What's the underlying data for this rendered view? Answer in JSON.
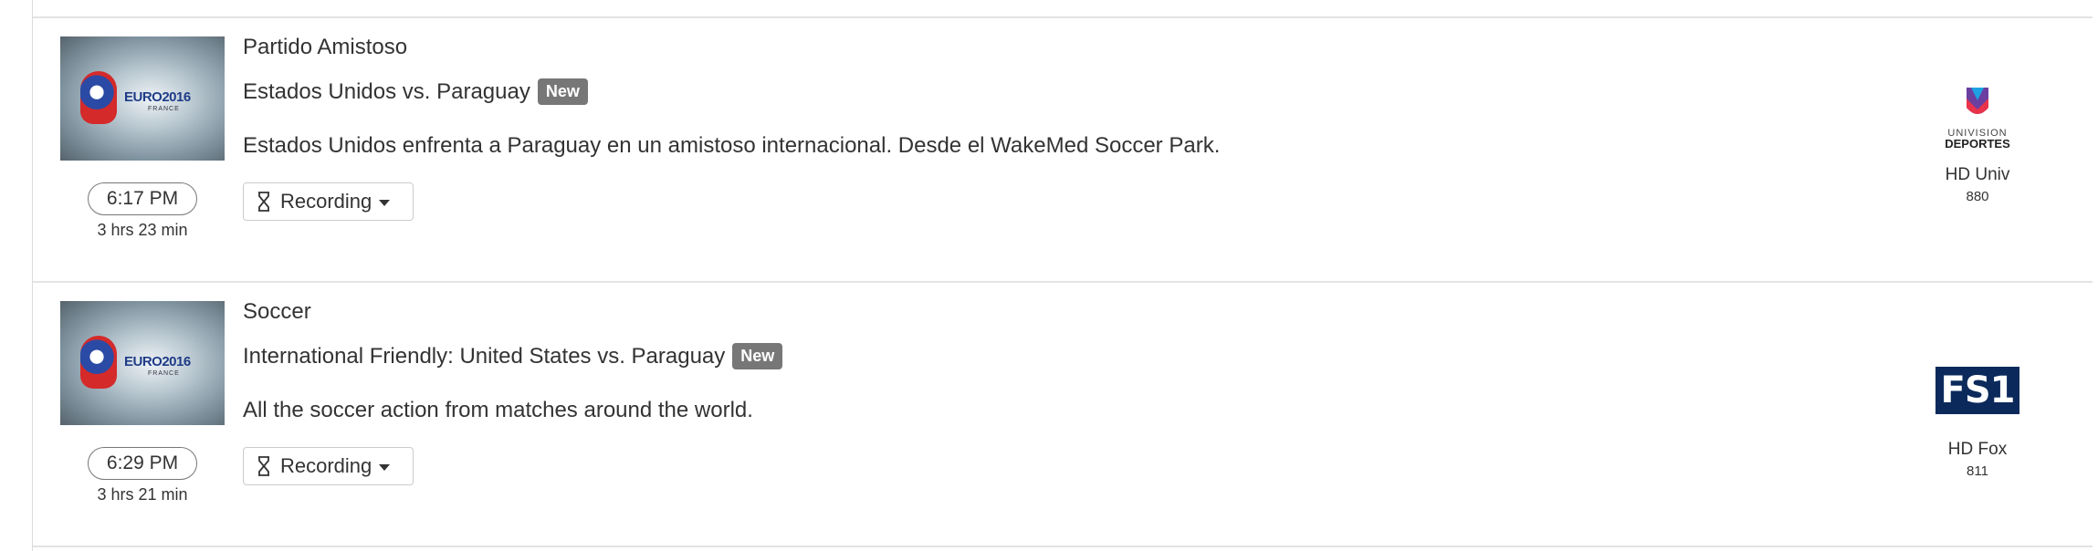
{
  "listings": [
    {
      "category": "Partido Amistoso",
      "title": "Estados Unidos vs. Paraguay",
      "badge": "New",
      "description": "Estados Unidos enfrenta a Paraguay en un amistoso internacional. Desde el WakeMed Soccer Park.",
      "time": "6:17 PM",
      "duration": "3 hrs 23 min",
      "recording_label": "Recording",
      "thumb_logo": "EURO2016",
      "thumb_sub": "FRANCE",
      "channel": {
        "logo_line1": "UNIVISION",
        "logo_line2": "DEPORTES",
        "name": "HD Univ",
        "number": "880",
        "logo_icon": "univision-deportes-logo"
      }
    },
    {
      "category": "Soccer",
      "title": "International Friendly: United States vs. Paraguay",
      "badge": "New",
      "description": "All the soccer action from matches around the world.",
      "time": "6:29 PM",
      "duration": "3 hrs 21 min",
      "recording_label": "Recording",
      "thumb_logo": "EURO2016",
      "thumb_sub": "FRANCE",
      "channel": {
        "logo_text": "FS1",
        "name": "HD Fox",
        "number": "811",
        "logo_icon": "fs1-logo"
      }
    }
  ],
  "colors": {
    "badge_bg": "#777777",
    "text": "#333333",
    "border": "#e3e3e3",
    "fs1_bg": "#0b2a5b"
  }
}
